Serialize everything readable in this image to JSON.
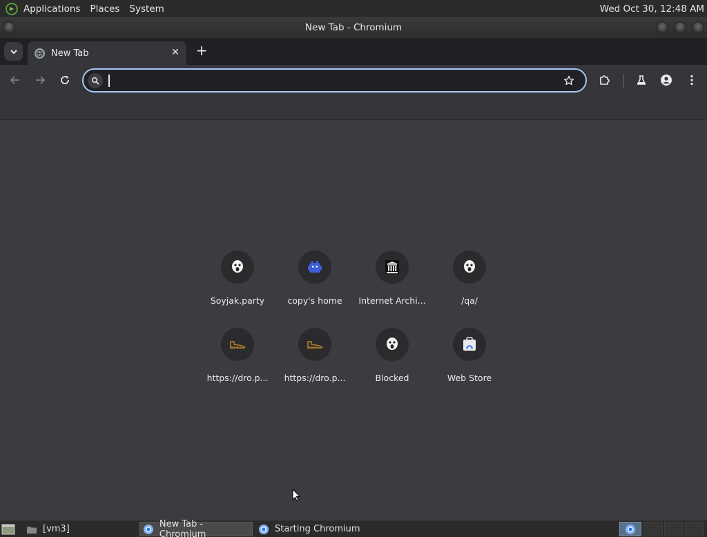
{
  "top_panel": {
    "menus": [
      "Applications",
      "Places",
      "System"
    ],
    "clock": "Wed Oct 30, 12:48 AM"
  },
  "window": {
    "title": "New Tab - Chromium"
  },
  "tabs": [
    {
      "title": "New Tab",
      "favicon": "globe-icon"
    }
  ],
  "omnibox": {
    "value": "",
    "placeholder": ""
  },
  "shortcuts": [
    {
      "label": "Soyjak.party",
      "icon": "soyjak-face-icon"
    },
    {
      "label": "copy's home",
      "icon": "pixel-monster-icon"
    },
    {
      "label": "Internet Archi...",
      "icon": "archive-building-icon"
    },
    {
      "label": "/qa/",
      "icon": "soyjak-face-icon"
    },
    {
      "label": "https://dro.p...",
      "icon": "shoe-icon"
    },
    {
      "label": "https://dro.p...",
      "icon": "shoe-icon"
    },
    {
      "label": "Blocked",
      "icon": "soyjak-face-icon"
    },
    {
      "label": "Web Store",
      "icon": "web-store-icon"
    }
  ],
  "taskbar": {
    "items": [
      "[vm3]",
      "New Tab - Chromium",
      "Starting Chromium"
    ]
  },
  "colors": {
    "accent_focus": "#a8c7fa",
    "content_bg": "#3c3c40",
    "toolbar_bg": "#35363a",
    "tabstrip_bg": "#202124"
  }
}
